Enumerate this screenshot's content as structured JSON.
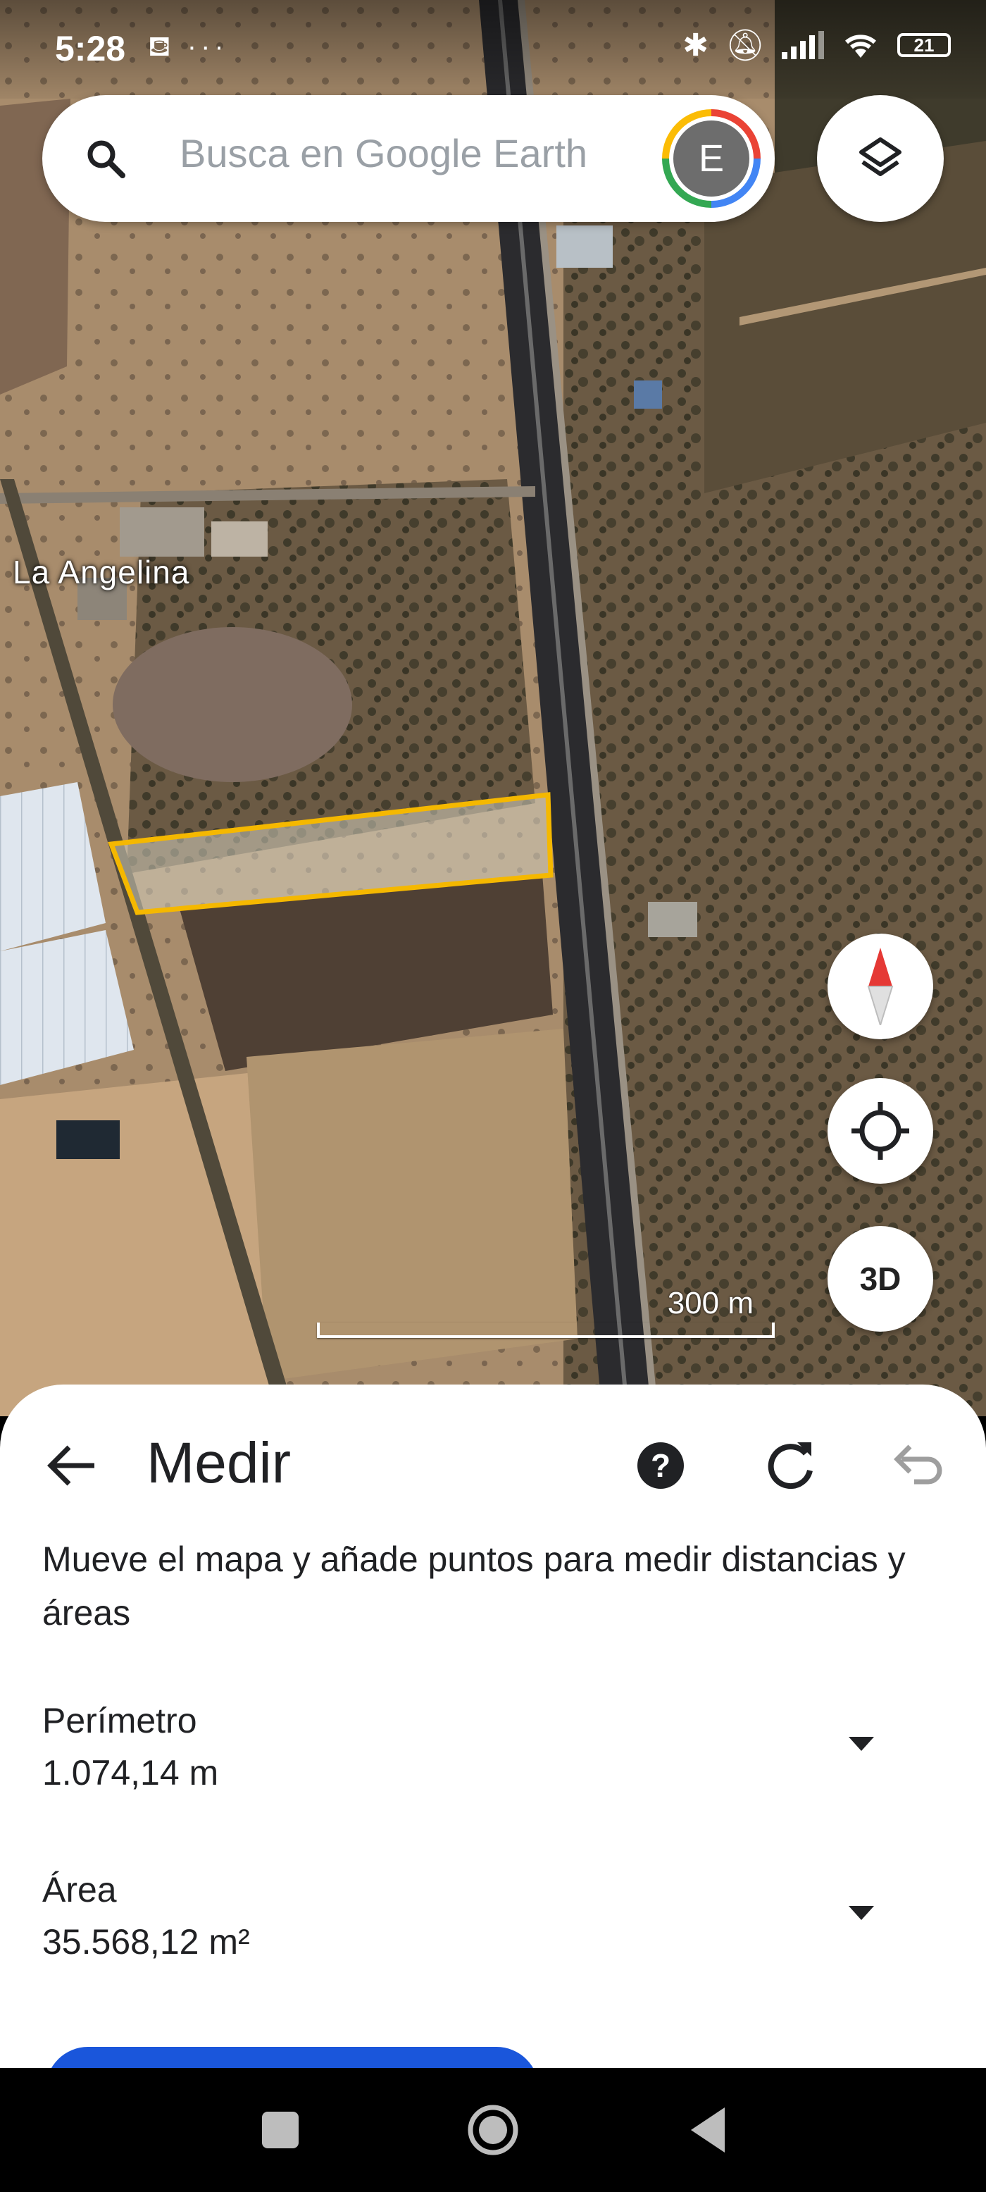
{
  "status_bar": {
    "time": "5:28",
    "left_icons": "⛾ ···",
    "battery": "21"
  },
  "search": {
    "placeholder": "Busca en Google Earth",
    "avatar_initial": "E"
  },
  "map": {
    "place_label": "La Angelina",
    "scale_label": "300 m",
    "button_3d": "3D",
    "measure_outline_color": "#f5b800"
  },
  "sheet": {
    "title": "Medir",
    "help_label": "?",
    "description": "Mueve el mapa y añade puntos para medir distancias y áreas",
    "perimeter": {
      "label": "Perímetro",
      "value": "1.074,14 m"
    },
    "area": {
      "label": "Área",
      "value": "35.568,12 m²"
    }
  },
  "colors": {
    "accent": "#1a56db",
    "text": "#202124"
  }
}
